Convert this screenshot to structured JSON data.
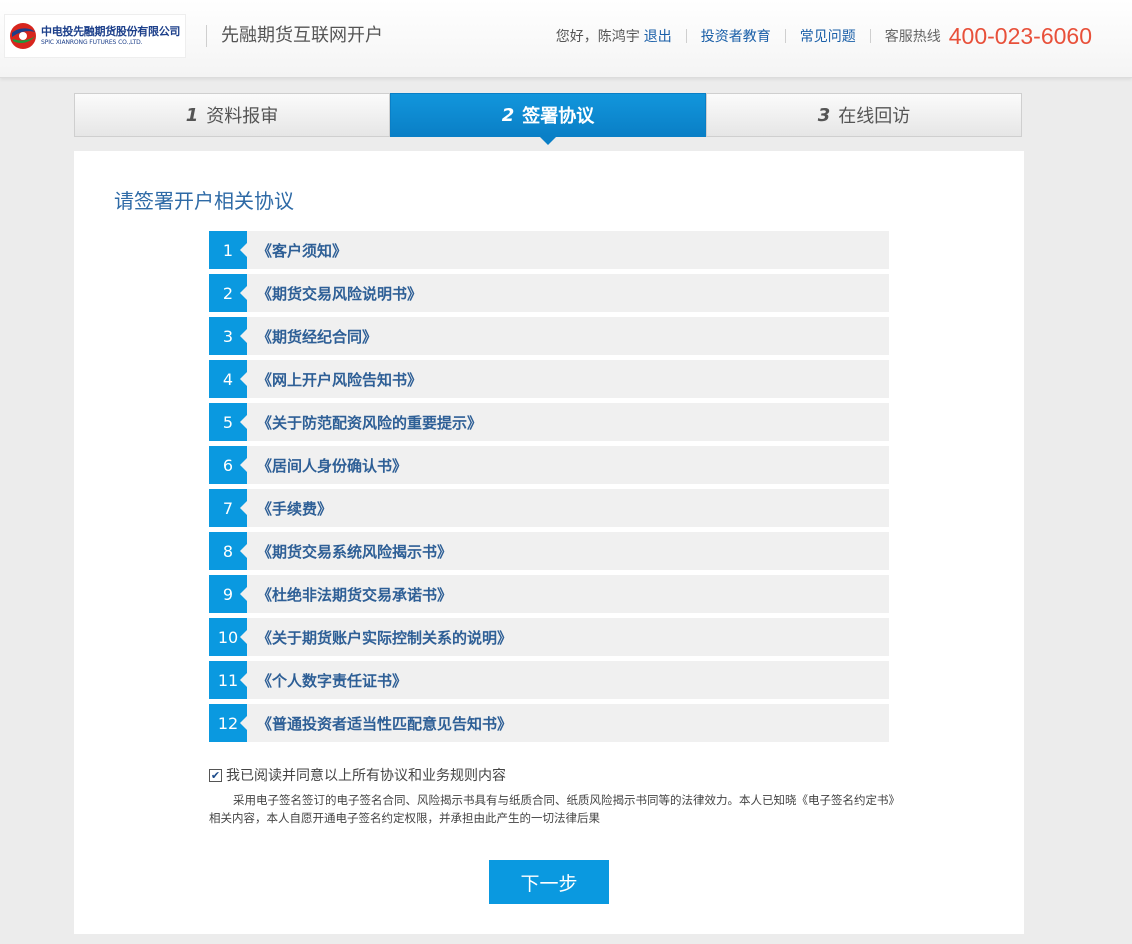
{
  "header": {
    "logo_cn": "中电投先融期货股份有限公司",
    "logo_en": "SPIC XIANRONG FUTURES CO.,LTD.",
    "app_title": "先融期货互联网开户",
    "greeting": "您好，陈鸿宇",
    "logout": "退出",
    "investor_education": "投资者教育",
    "faq": "常见问题",
    "hotline_label": "客服热线",
    "hotline": "400-023-6060"
  },
  "steps": [
    {
      "num": "1",
      "label": "资料报审"
    },
    {
      "num": "2",
      "label": "签署协议"
    },
    {
      "num": "3",
      "label": "在线回访"
    }
  ],
  "active_step": 2,
  "main": {
    "title": "请签署开户相关协议",
    "documents": [
      {
        "num": "1",
        "label": "《客户须知》"
      },
      {
        "num": "2",
        "label": "《期货交易风险说明书》"
      },
      {
        "num": "3",
        "label": "《期货经纪合同》"
      },
      {
        "num": "4",
        "label": "《网上开户风险告知书》"
      },
      {
        "num": "5",
        "label": "《关于防范配资风险的重要提示》"
      },
      {
        "num": "6",
        "label": "《居间人身份确认书》"
      },
      {
        "num": "7",
        "label": "《手续费》"
      },
      {
        "num": "8",
        "label": "《期货交易系统风险揭示书》"
      },
      {
        "num": "9",
        "label": "《杜绝非法期货交易承诺书》"
      },
      {
        "num": "10",
        "label": "《关于期货账户实际控制关系的说明》"
      },
      {
        "num": "11",
        "label": "《个人数字责任证书》"
      },
      {
        "num": "12",
        "label": "《普通投资者适当性匹配意见告知书》"
      }
    ],
    "agree_checked": true,
    "agree_label": "我已阅读并同意以上所有协议和业务规则内容",
    "agree_note": "采用电子签名签订的电子签名合同、风险揭示书具有与纸质合同、纸质风险揭示书同等的法律效力。本人已知晓《电子签名约定书》相关内容，本人自愿开通电子签名约定权限，并承担由此产生的一切法律后果",
    "next_button": "下一步"
  },
  "colors": {
    "accent": "#0a99e0",
    "hotline": "#e8503a",
    "link": "#1a5fa8"
  }
}
